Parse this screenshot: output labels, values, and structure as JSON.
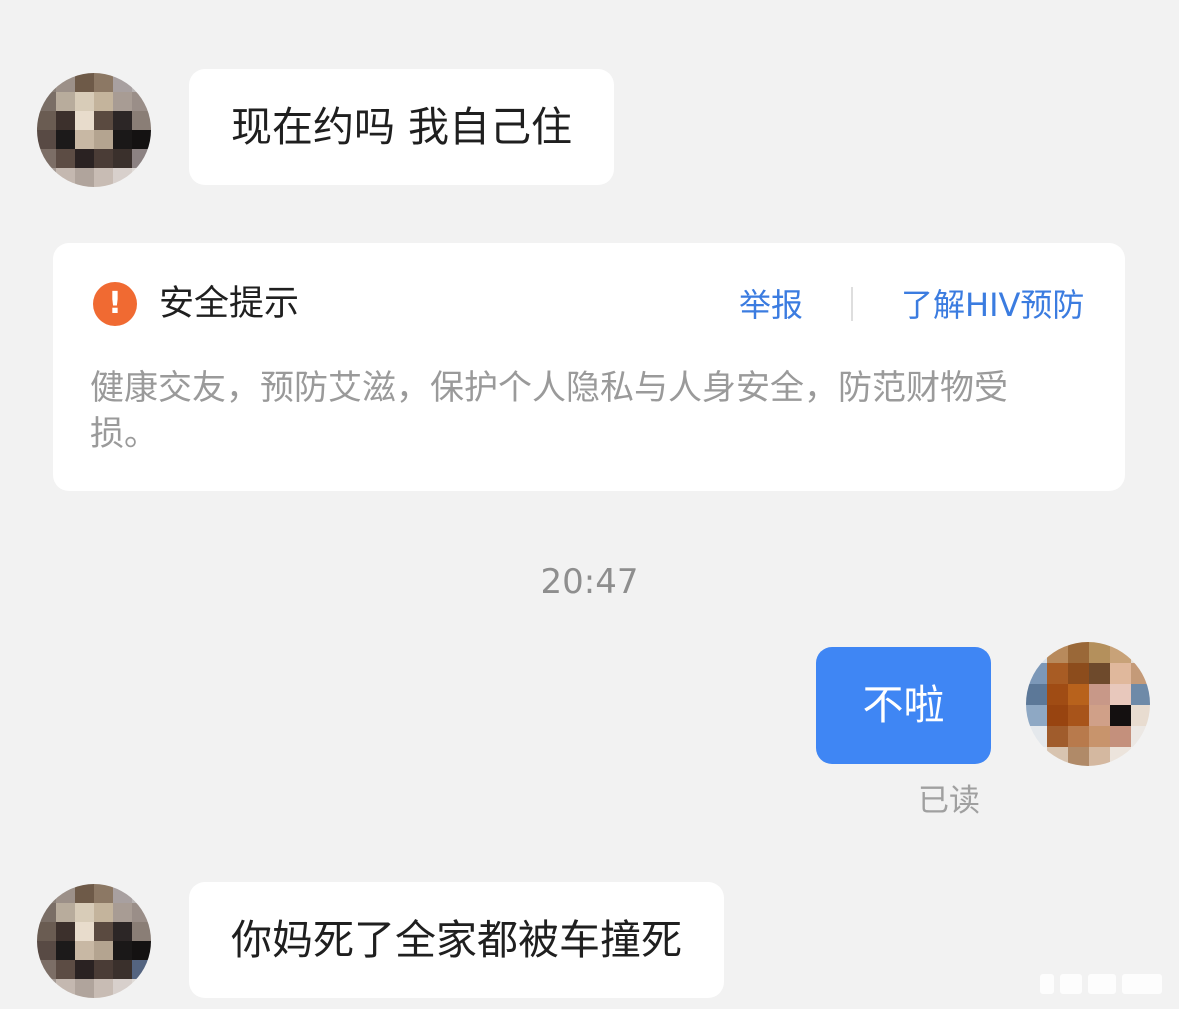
{
  "messages": [
    {
      "direction": "incoming",
      "text": "现在约吗 我自己住"
    },
    {
      "direction": "outgoing",
      "text": "不啦",
      "status": "已读"
    },
    {
      "direction": "incoming",
      "text": "你妈死了全家都被车撞死"
    }
  ],
  "safety_notice": {
    "icon": "warning-icon",
    "title": "安全提示",
    "report_label": "举报",
    "learn_label": "了解HIV预防",
    "body": "健康交友，预防艾滋，保护个人隐私与人身安全，防范财物受损。"
  },
  "timestamp": "20:47",
  "colors": {
    "background": "#f2f2f2",
    "incoming_bubble": "#ffffff",
    "outgoing_bubble": "#3f86f4",
    "warning": "#f06a32",
    "link": "#3b7ce0"
  }
}
